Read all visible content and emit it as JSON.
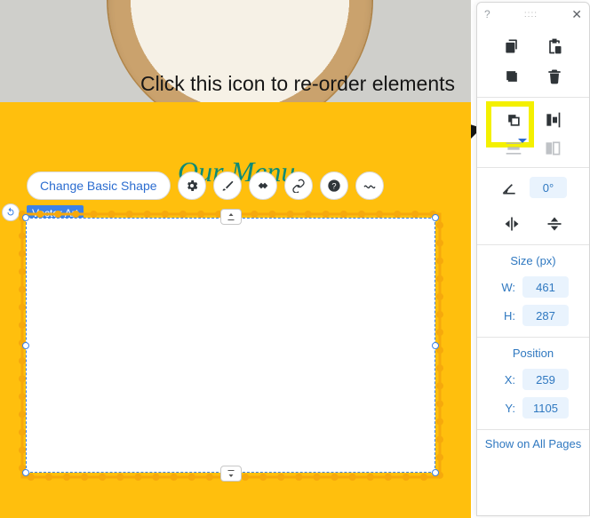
{
  "annotation": {
    "text": "Click this icon to re-order elements"
  },
  "canvas": {
    "heading": "Our Menu",
    "selection_label": "Vector Art",
    "toolbar": {
      "change_shape": "Change Basic Shape"
    }
  },
  "panel": {
    "rotation": "0°",
    "size": {
      "title": "Size (px)",
      "w_label": "W:",
      "w": "461",
      "h_label": "H:",
      "h": "287"
    },
    "position": {
      "title": "Position",
      "x_label": "X:",
      "x": "259",
      "y_label": "Y:",
      "y": "1105"
    },
    "show_on_all": "Show on All Pages"
  }
}
